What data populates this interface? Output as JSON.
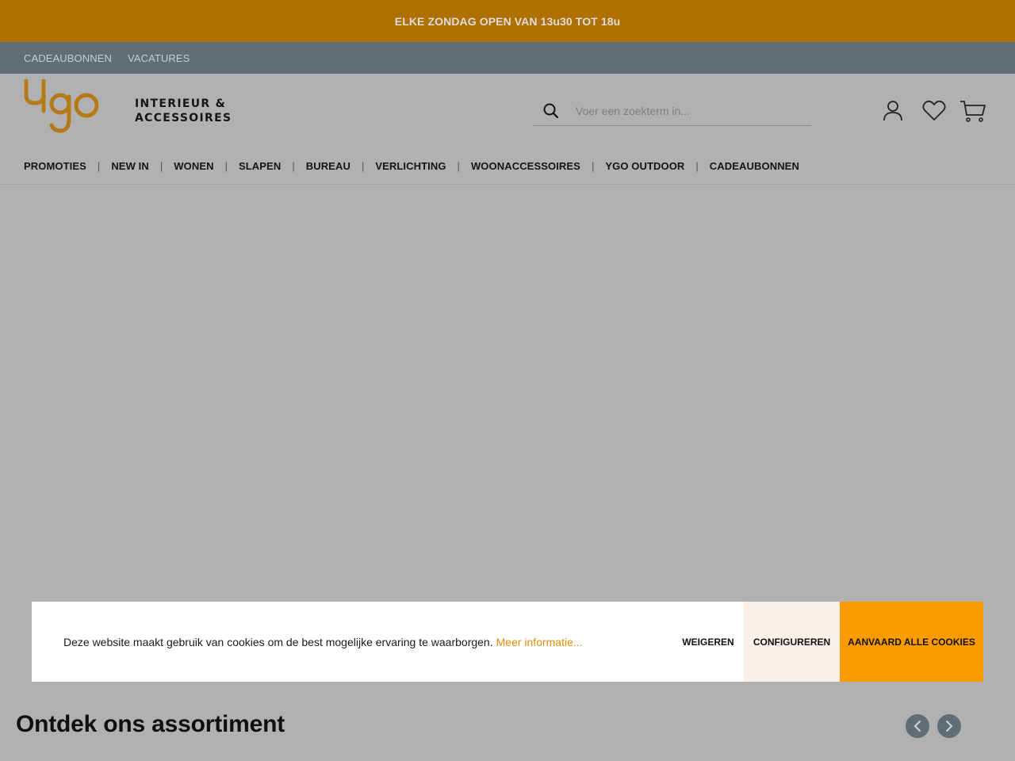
{
  "promo": {
    "text": "ELKE ZONDAG OPEN VAN 13u30 TOT 18u"
  },
  "top_links": [
    {
      "label": "CADEAUBONNEN"
    },
    {
      "label": "VACATURES"
    }
  ],
  "logo": {
    "brand": "Ygo",
    "line1": "INTERIEUR &",
    "line2": "ACCESSOIRES"
  },
  "search": {
    "placeholder": "Voer een zoekterm in..."
  },
  "icons": {
    "search": "search-icon",
    "account": "user-icon",
    "wishlist": "heart-icon",
    "cart": "cart-icon",
    "prev": "chevron-left-icon",
    "next": "chevron-right-icon"
  },
  "nav": [
    {
      "label": "PROMOTIES"
    },
    {
      "label": "NEW IN"
    },
    {
      "label": "WONEN"
    },
    {
      "label": "SLAPEN"
    },
    {
      "label": "BUREAU"
    },
    {
      "label": "VERLICHTING"
    },
    {
      "label": "WOONACCESSOIRES"
    },
    {
      "label": "YGO OUTDOOR"
    },
    {
      "label": "CADEAUBONNEN"
    }
  ],
  "nav_separator": "|",
  "cookie": {
    "text": "Deze website maakt gebruik van cookies om de best mogelijke ervaring te waarborgen.",
    "link": "Meer informatie...",
    "refuse": "WEIGEREN",
    "configure": "CONFIGUREREN",
    "accept": "AANVAARD ALLE COOKIES"
  },
  "section": {
    "title": "Ontdek ons assortiment"
  },
  "colors": {
    "promo_bg": "#b07000",
    "toplinks_bg": "#5f6e74",
    "overlay_bg": "#b1b1b1",
    "accent": "#fa9c00",
    "logo": "#b57a17"
  }
}
